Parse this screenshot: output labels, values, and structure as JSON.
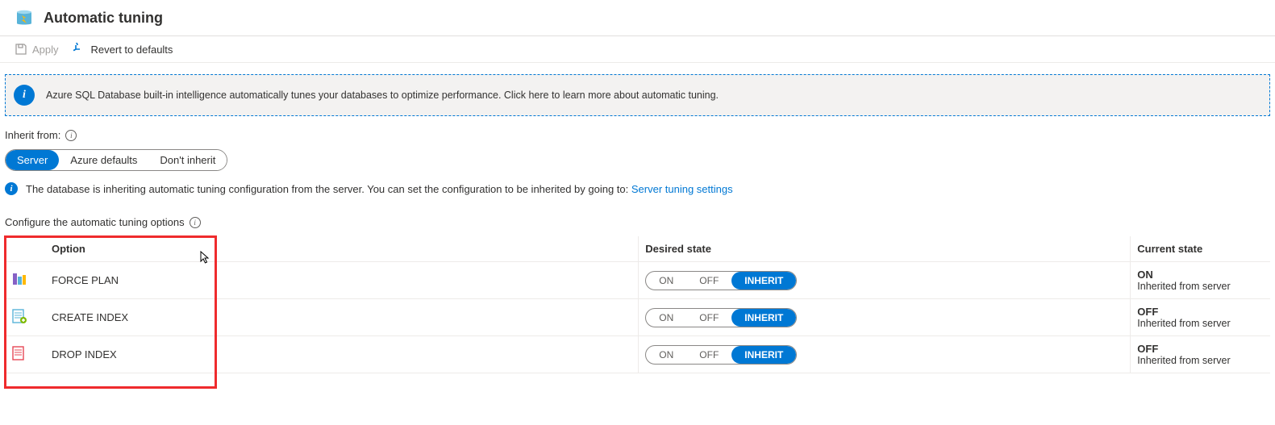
{
  "header": {
    "title": "Automatic tuning"
  },
  "actions": {
    "apply_label": "Apply",
    "revert_label": "Revert to defaults"
  },
  "info_banner": {
    "text": "Azure SQL Database built-in intelligence automatically tunes your databases to optimize performance. Click here to learn more about automatic tuning."
  },
  "inherit": {
    "label": "Inherit from:",
    "options": [
      "Server",
      "Azure defaults",
      "Don't inherit"
    ],
    "selected": "Server",
    "note_prefix": "The database is inheriting automatic tuning configuration from the server. You can set the configuration to be inherited by going to: ",
    "note_link": "Server tuning settings"
  },
  "configure": {
    "label": "Configure the automatic tuning options",
    "columns": {
      "option": "Option",
      "desired": "Desired state",
      "current": "Current state"
    },
    "state_labels": {
      "on": "ON",
      "off": "OFF",
      "inherit": "INHERIT"
    },
    "rows": [
      {
        "name": "FORCE PLAN",
        "desired": "INHERIT",
        "current_value": "ON",
        "current_source": "Inherited from server"
      },
      {
        "name": "CREATE INDEX",
        "desired": "INHERIT",
        "current_value": "OFF",
        "current_source": "Inherited from server"
      },
      {
        "name": "DROP INDEX",
        "desired": "INHERIT",
        "current_value": "OFF",
        "current_source": "Inherited from server"
      }
    ]
  }
}
